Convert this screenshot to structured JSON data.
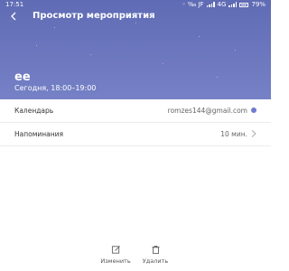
{
  "status_bar": {
    "time": "17:51",
    "indicators": "◦ ‰ JF",
    "network": "4G",
    "battery": "79%"
  },
  "header": {
    "title": "Просмотр мероприятия",
    "back_icon": "chevron-left-icon"
  },
  "event": {
    "name": "ee",
    "datetime": "Сегодня, 18:00–19:00"
  },
  "details": {
    "calendar": {
      "label": "Календарь",
      "value": "romzes144@gmail.com",
      "dot_color": "#6e7bd0"
    },
    "reminders": {
      "label": "Напоминания",
      "value": "10 мин."
    }
  },
  "actions": {
    "edit": {
      "label": "Изменить",
      "icon": "edit-icon"
    },
    "delete": {
      "label": "Удалить",
      "icon": "trash-icon"
    }
  },
  "colors": {
    "header_top": "#5f6bb4",
    "header_bottom": "#7782c7",
    "accent": "#6e7bd0"
  }
}
